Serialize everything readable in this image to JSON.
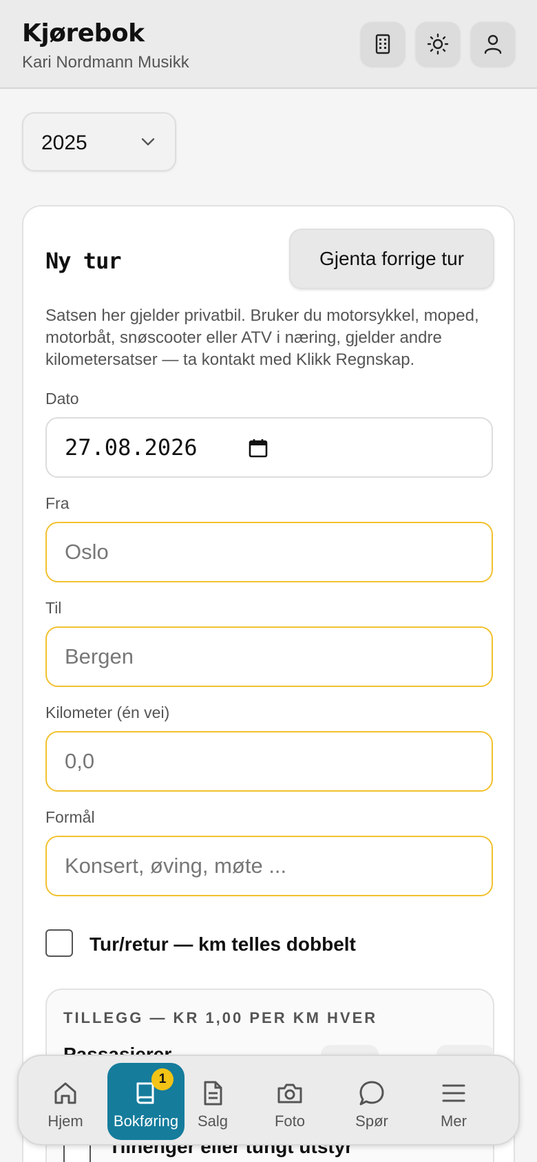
{
  "header": {
    "title": "Kjørebok",
    "subtitle": "Kari Nordmann Musikk",
    "icons": [
      "building-icon",
      "sun-icon",
      "user-icon"
    ]
  },
  "year_select": {
    "value": "2025"
  },
  "form": {
    "title": "Ny tur",
    "repeat_button": "Gjenta forrige tur",
    "notice": "Satsen her gjelder privatbil. Bruker du motorsykkel, moped, motorbåt, snøscooter eller ATV i næring, gjelder andre kilometersatser — ta kontakt med Klikk Regnskap.",
    "date": {
      "label": "Dato",
      "value": "27.08.2026"
    },
    "from": {
      "label": "Fra",
      "placeholder": "Oslo"
    },
    "to": {
      "label": "Til",
      "placeholder": "Bergen"
    },
    "km": {
      "label": "Kilometer (én vei)",
      "placeholder": "0,0"
    },
    "purpose": {
      "label": "Formål",
      "placeholder": "Konsert, øving, møte ..."
    },
    "round_trip": {
      "label": "Tur/retur — km telles dobbelt",
      "checked": false
    },
    "extras": {
      "heading": "TILLEGG — KR 1,00 PER KM HVER",
      "passengers_label": "Passasjerer",
      "trailer_label": "Tilhenger eller tungt utstyr"
    }
  },
  "nav": {
    "items": [
      {
        "label": "Hjem",
        "icon": "home-icon"
      },
      {
        "label": "Bokføring",
        "icon": "book-icon",
        "badge": "1",
        "active": true
      },
      {
        "label": "Salg",
        "icon": "document-icon"
      },
      {
        "label": "Foto",
        "icon": "camera-icon"
      },
      {
        "label": "Spør",
        "icon": "chat-bubble-icon"
      },
      {
        "label": "Mer",
        "icon": "menu-icon"
      }
    ]
  },
  "colors": {
    "accent": "#157c9c",
    "field_border": "#f2c12e",
    "badge": "#f3c316"
  }
}
